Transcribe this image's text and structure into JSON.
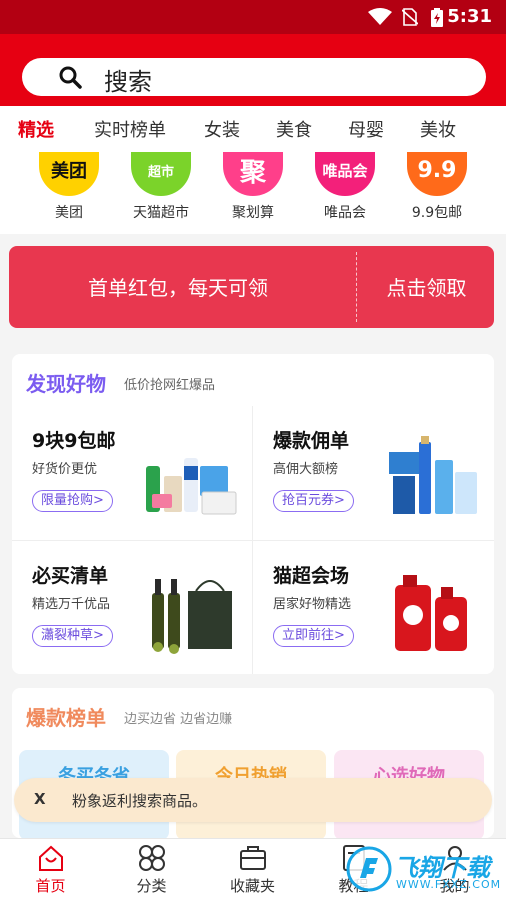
{
  "status_bar": {
    "time": "5:31"
  },
  "search": {
    "placeholder": "搜索"
  },
  "tabs": [
    "精选",
    "实时榜单",
    "女装",
    "美食",
    "母婴",
    "美妆"
  ],
  "categories": [
    {
      "label": "美团",
      "icon_text": "美团",
      "color": "#ffd100"
    },
    {
      "label": "天猫超市",
      "icon_text": "超市",
      "color": "#7bd32a"
    },
    {
      "label": "聚划算",
      "icon_text": "聚",
      "color": "#ff3f8a"
    },
    {
      "label": "唯品会",
      "icon_text": "唯品会",
      "color": "#f3207a"
    },
    {
      "label": "9.9包邮",
      "icon_text": "9.9",
      "color": "#ff6a1a"
    }
  ],
  "banner": {
    "left": "首单红包，每天可领",
    "right": "点击领取"
  },
  "discover": {
    "title": "发现好物",
    "subtitle": "低价抢网红爆品",
    "items": [
      {
        "title": "9块9包邮",
        "subtitle": "好货价更优",
        "button": "限量抢购>"
      },
      {
        "title": "爆款佣单",
        "subtitle": "高佣大额榜",
        "button": "抢百元券>"
      },
      {
        "title": "必买清单",
        "subtitle": "精选万千优品",
        "button": "瀟裂种草>"
      },
      {
        "title": "猫超会场",
        "subtitle": "居家好物精选",
        "button": "立即前往>"
      }
    ]
  },
  "ranking": {
    "title": "爆款榜单",
    "subtitle": "边买边省 边省边赚",
    "boxes": [
      {
        "label": "冬买冬省",
        "bg": "#dff0fb",
        "fg": "#3aa0e0"
      },
      {
        "label": "今日热销",
        "bg": "#fdf0d8",
        "fg": "#f0a030"
      },
      {
        "label": "心选好物",
        "bg": "#fbe6f3",
        "fg": "#e06ab8"
      }
    ]
  },
  "toast": {
    "close": "X",
    "text": "粉象返利搜索商品。"
  },
  "bottom_nav": [
    "首页",
    "分类",
    "收藏夹",
    "教程",
    "我的"
  ],
  "watermark": {
    "text": "飞翔下载",
    "url": "WWW.FXXZ.COM"
  },
  "colors": {
    "brand_red": "#e60012",
    "accent_purple": "#7b5cf0",
    "banner": "#e8374f"
  }
}
